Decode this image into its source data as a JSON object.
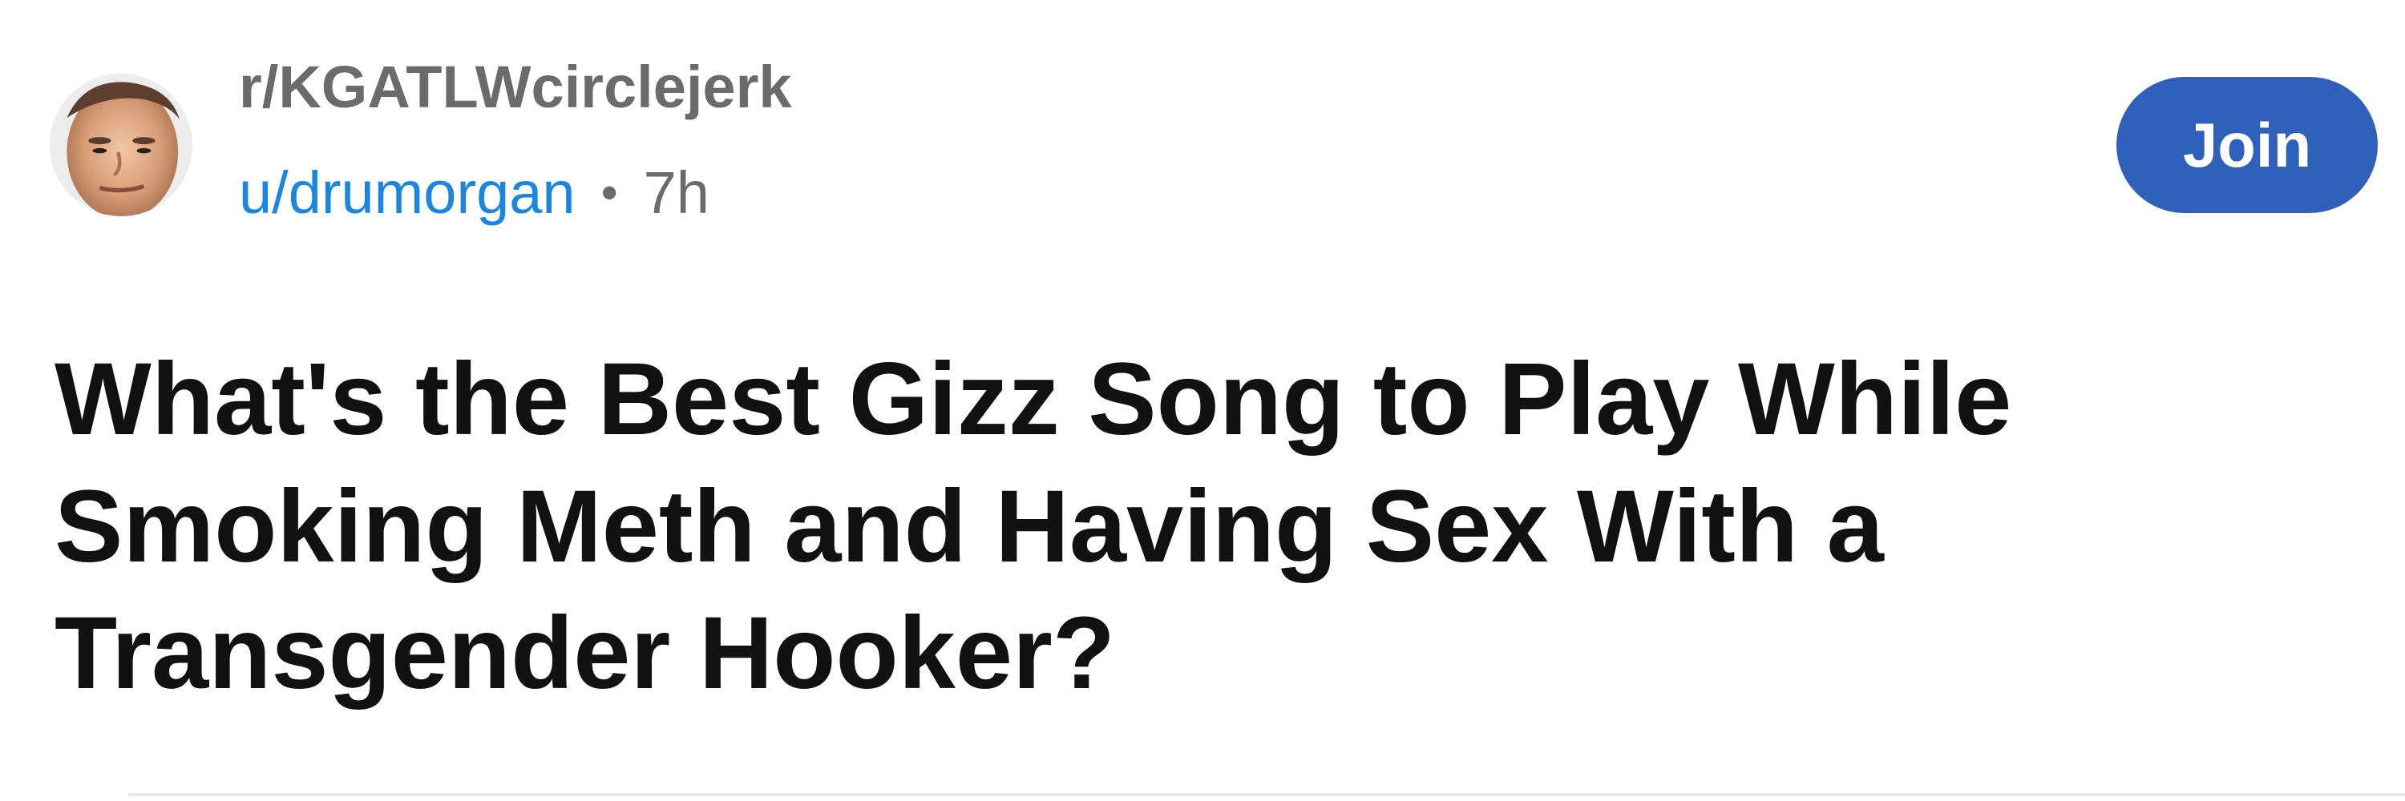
{
  "post": {
    "subreddit": "r/KGATLWcirclejerk",
    "username": "u/drumorgan",
    "separator": "•",
    "age": "7h",
    "join_label": "Join",
    "title": "What's the Best Gizz Song to Play While Smoking Meth and Having Sex With a Transgender Hooker?"
  },
  "colors": {
    "subreddit_text": "#6b6b6b",
    "username_text": "#1b86e0",
    "join_button": "#2f60ba",
    "title_text": "#111111"
  }
}
